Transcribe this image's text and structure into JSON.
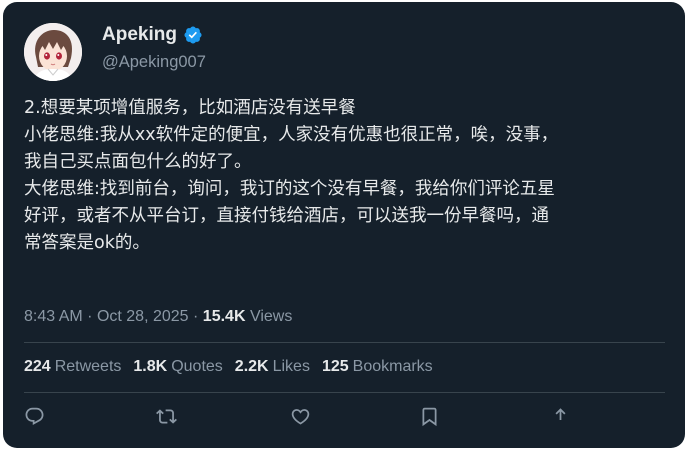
{
  "author": {
    "display_name": "Apeking",
    "handle": "@Apeking007",
    "verified": true
  },
  "tweet": {
    "lines": [
      "2.想要某项增值服务，比如酒店没有送早餐",
      "小佬思维:我从xx软件定的便宜，人家没有优惠也很正常，唉，没事，",
      "我自己买点面包什么的好了。",
      "大佬思维:找到前台，询问，我订的这个没有早餐，我给你们评论五星",
      "好评，或者不从平台订，直接付钱给酒店，可以送我一份早餐吗，通",
      "常答案是ok的。"
    ]
  },
  "meta": {
    "time": "8:43 AM",
    "date": "Oct 28, 2025",
    "views_count": "15.4K",
    "views_label": "Views"
  },
  "stats": {
    "retweets_count": "224",
    "retweets_label": "Retweets",
    "quotes_count": "1.8K",
    "quotes_label": "Quotes",
    "likes_count": "2.2K",
    "likes_label": "Likes",
    "bookmarks_count": "125",
    "bookmarks_label": "Bookmarks"
  },
  "actions": [
    "reply-icon",
    "retweet-icon",
    "like-icon",
    "bookmark-icon",
    "share-icon"
  ],
  "colors": {
    "background": "#15202b",
    "text_primary": "#e7e9ea",
    "text_secondary": "#8b98a5",
    "divider": "#38444d",
    "verified": "#1d9bf0"
  }
}
